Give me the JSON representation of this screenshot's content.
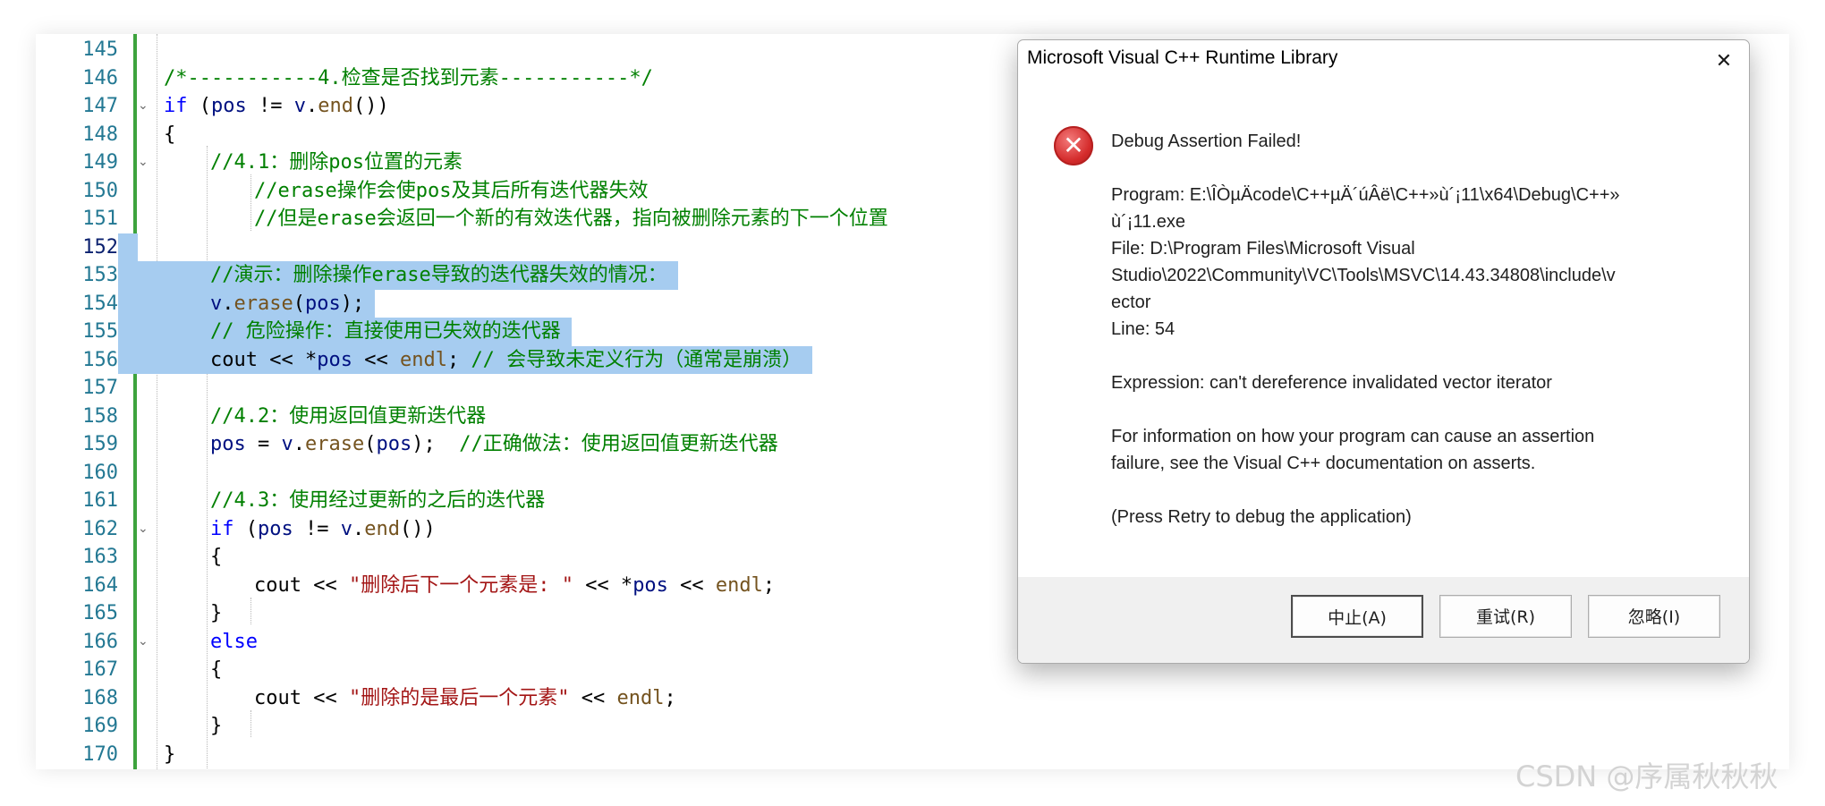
{
  "editor": {
    "highlight_lines": [
      152,
      153,
      154,
      155,
      156
    ],
    "current_line": 152,
    "lines": [
      {
        "n": "145",
        "indent": 0,
        "fold": "",
        "tokens": []
      },
      {
        "n": "146",
        "indent": 1,
        "fold": "",
        "tokens": [
          {
            "t": "/*-----------4.检查是否找到元素-----------*/",
            "c": "c-cmt"
          }
        ]
      },
      {
        "n": "147",
        "indent": 1,
        "fold": "⌄",
        "tokens": [
          {
            "t": "if",
            "c": "c-kw"
          },
          {
            "t": " (",
            "c": "c-sep"
          },
          {
            "t": "pos",
            "c": "c-var"
          },
          {
            "t": " != ",
            "c": "c-sep"
          },
          {
            "t": "v",
            "c": "c-var"
          },
          {
            "t": ".",
            "c": "c-sep"
          },
          {
            "t": "end",
            "c": "c-fn"
          },
          {
            "t": "())",
            "c": "c-sep"
          }
        ]
      },
      {
        "n": "148",
        "indent": 1,
        "fold": "",
        "tokens": [
          {
            "t": "{",
            "c": "c-sep"
          }
        ]
      },
      {
        "n": "149",
        "indent": 2,
        "fold": "⌄",
        "tokens": [
          {
            "t": "//4.1：删除pos位置的元素",
            "c": "c-cmt"
          }
        ]
      },
      {
        "n": "150",
        "indent": 3,
        "fold": "",
        "tokens": [
          {
            "t": "//erase操作会使pos及其后所有迭代器失效",
            "c": "c-cmt"
          }
        ]
      },
      {
        "n": "151",
        "indent": 3,
        "fold": "",
        "tokens": [
          {
            "t": "//但是erase会返回一个新的有效迭代器，指向被删除元素的下一个位置",
            "c": "c-cmt"
          }
        ]
      },
      {
        "n": "152",
        "indent": 0,
        "fold": "",
        "tokens": []
      },
      {
        "n": "153",
        "indent": 2,
        "fold": "",
        "tokens": [
          {
            "t": "//演示：删除操作erase导致的迭代器失效的情况：",
            "c": "c-cmt"
          }
        ]
      },
      {
        "n": "154",
        "indent": 2,
        "fold": "",
        "tokens": [
          {
            "t": "v",
            "c": "c-var"
          },
          {
            "t": ".",
            "c": "c-sep"
          },
          {
            "t": "erase",
            "c": "c-fn"
          },
          {
            "t": "(",
            "c": "c-sep"
          },
          {
            "t": "pos",
            "c": "c-var"
          },
          {
            "t": ");",
            "c": "c-sep"
          }
        ]
      },
      {
        "n": "155",
        "indent": 2,
        "fold": "",
        "tokens": [
          {
            "t": "// 危险操作：直接使用已失效的迭代器",
            "c": "c-cmt"
          }
        ]
      },
      {
        "n": "156",
        "indent": 2,
        "fold": "",
        "tokens": [
          {
            "t": "cout",
            "c": "c-id"
          },
          {
            "t": " << *",
            "c": "c-sep"
          },
          {
            "t": "pos",
            "c": "c-var"
          },
          {
            "t": " << ",
            "c": "c-sep"
          },
          {
            "t": "endl",
            "c": "c-fn"
          },
          {
            "t": "; ",
            "c": "c-sep"
          },
          {
            "t": "// 会导致未定义行为（通常是崩溃）",
            "c": "c-cmt"
          }
        ]
      },
      {
        "n": "157",
        "indent": 0,
        "fold": "",
        "tokens": []
      },
      {
        "n": "158",
        "indent": 2,
        "fold": "",
        "tokens": [
          {
            "t": "//4.2：使用返回值更新迭代器",
            "c": "c-cmt"
          }
        ]
      },
      {
        "n": "159",
        "indent": 2,
        "fold": "",
        "tokens": [
          {
            "t": "pos",
            "c": "c-var"
          },
          {
            "t": " = ",
            "c": "c-sep"
          },
          {
            "t": "v",
            "c": "c-var"
          },
          {
            "t": ".",
            "c": "c-sep"
          },
          {
            "t": "erase",
            "c": "c-fn"
          },
          {
            "t": "(",
            "c": "c-sep"
          },
          {
            "t": "pos",
            "c": "c-var"
          },
          {
            "t": ");  ",
            "c": "c-sep"
          },
          {
            "t": "//正确做法：使用返回值更新迭代器",
            "c": "c-cmt"
          }
        ]
      },
      {
        "n": "160",
        "indent": 0,
        "fold": "",
        "tokens": []
      },
      {
        "n": "161",
        "indent": 2,
        "fold": "",
        "tokens": [
          {
            "t": "//4.3：使用经过更新的之后的迭代器",
            "c": "c-cmt"
          }
        ]
      },
      {
        "n": "162",
        "indent": 2,
        "fold": "⌄",
        "tokens": [
          {
            "t": "if",
            "c": "c-kw"
          },
          {
            "t": " (",
            "c": "c-sep"
          },
          {
            "t": "pos",
            "c": "c-var"
          },
          {
            "t": " != ",
            "c": "c-sep"
          },
          {
            "t": "v",
            "c": "c-var"
          },
          {
            "t": ".",
            "c": "c-sep"
          },
          {
            "t": "end",
            "c": "c-fn"
          },
          {
            "t": "())",
            "c": "c-sep"
          }
        ]
      },
      {
        "n": "163",
        "indent": 2,
        "fold": "",
        "tokens": [
          {
            "t": "{",
            "c": "c-sep"
          }
        ]
      },
      {
        "n": "164",
        "indent": 3,
        "fold": "",
        "tokens": [
          {
            "t": "cout",
            "c": "c-id"
          },
          {
            "t": " << ",
            "c": "c-sep"
          },
          {
            "t": "\"删除后下一个元素是: \"",
            "c": "c-str"
          },
          {
            "t": " << *",
            "c": "c-sep"
          },
          {
            "t": "pos",
            "c": "c-var"
          },
          {
            "t": " << ",
            "c": "c-sep"
          },
          {
            "t": "endl",
            "c": "c-fn"
          },
          {
            "t": ";",
            "c": "c-sep"
          }
        ]
      },
      {
        "n": "165",
        "indent": 2,
        "fold": "",
        "tokens": [
          {
            "t": "}",
            "c": "c-sep"
          }
        ]
      },
      {
        "n": "166",
        "indent": 2,
        "fold": "⌄",
        "tokens": [
          {
            "t": "else",
            "c": "c-kw"
          }
        ]
      },
      {
        "n": "167",
        "indent": 2,
        "fold": "",
        "tokens": [
          {
            "t": "{",
            "c": "c-sep"
          }
        ]
      },
      {
        "n": "168",
        "indent": 3,
        "fold": "",
        "tokens": [
          {
            "t": "cout",
            "c": "c-id"
          },
          {
            "t": " << ",
            "c": "c-sep"
          },
          {
            "t": "\"删除的是最后一个元素\"",
            "c": "c-str"
          },
          {
            "t": " << ",
            "c": "c-sep"
          },
          {
            "t": "endl",
            "c": "c-fn"
          },
          {
            "t": ";",
            "c": "c-sep"
          }
        ]
      },
      {
        "n": "169",
        "indent": 2,
        "fold": "",
        "tokens": [
          {
            "t": "}",
            "c": "c-sep"
          }
        ]
      },
      {
        "n": "170",
        "indent": 1,
        "fold": "",
        "tokens": [
          {
            "t": "}",
            "c": "c-sep"
          }
        ]
      }
    ]
  },
  "dialog": {
    "title": "Microsoft Visual C++ Runtime Library",
    "close_glyph": "✕",
    "icon_glyph": "✕",
    "heading": "Debug Assertion Failed!",
    "program": "Program: E:\\ÎÒµÄcode\\C++µÄ´úÂë\\C++»ù´¡11\\x64\\Debug\\C++»\nù´¡11.exe",
    "file": "File: D:\\Program Files\\Microsoft Visual\nStudio\\2022\\Community\\VC\\Tools\\MSVC\\14.43.34808\\include\\v\nector",
    "line": "Line: 54",
    "expression": "Expression: can't dereference invalidated vector iterator",
    "info": "For information on how your program can cause an assertion\nfailure, see the Visual C++ documentation on asserts.",
    "retry_hint": "(Press Retry to debug the application)",
    "buttons": {
      "abort": "中止(A)",
      "retry": "重试(R)",
      "ignore": "忽略(I)"
    }
  },
  "watermark": "CSDN @序属秋秋秋"
}
